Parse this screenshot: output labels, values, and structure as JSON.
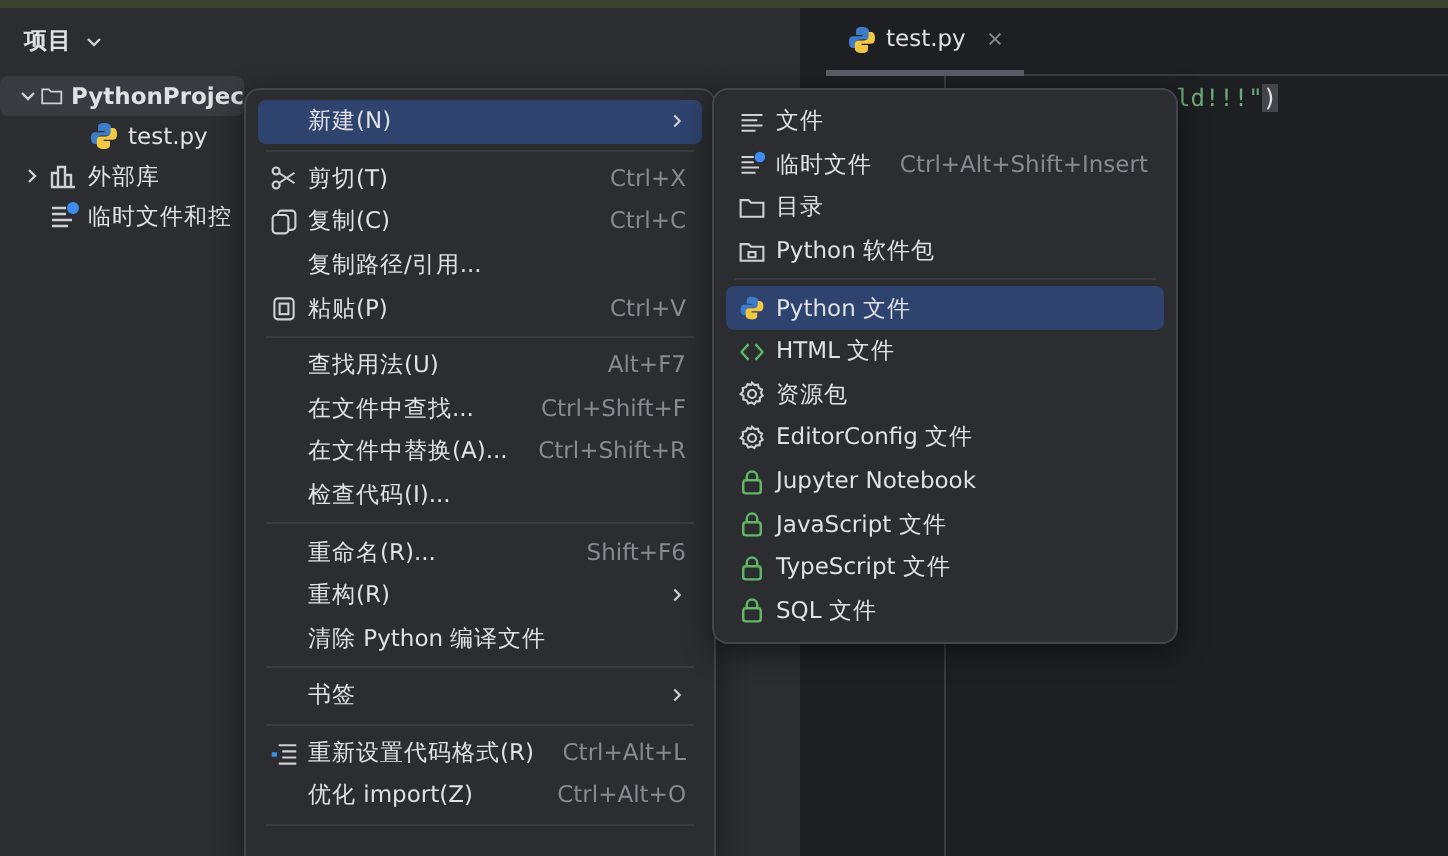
{
  "project_panel": {
    "title": "项目",
    "tree": [
      {
        "label": "PythonProjec",
        "kind": "folder",
        "expanded": true,
        "selected": true,
        "children": [
          {
            "label": "test.py",
            "kind": "python",
            "selected": false
          }
        ]
      },
      {
        "label": "外部库",
        "kind": "library",
        "expanded": false,
        "selected": false
      },
      {
        "label": "临时文件和控",
        "kind": "scratches",
        "selected": false
      }
    ]
  },
  "editor": {
    "tabs": [
      {
        "label": "test.py",
        "selected": true
      }
    ],
    "code_tokens": [
      {
        "text": "ld!!!\"",
        "kind": "string"
      },
      {
        "text": ")",
        "kind": "bracket-match"
      }
    ]
  },
  "context_menu": {
    "items": [
      {
        "kind": "plain",
        "label": "新建(N)",
        "submenu": true,
        "selected": true
      },
      {
        "kind": "separator"
      },
      {
        "kind": "cut",
        "label": "剪切(T)",
        "shortcut": "Ctrl+X",
        "selected": false
      },
      {
        "kind": "copy",
        "label": "复制(C)",
        "shortcut": "Ctrl+C",
        "selected": false
      },
      {
        "kind": "plain",
        "label": "复制路径/引用...",
        "selected": false
      },
      {
        "kind": "paste",
        "label": "粘贴(P)",
        "shortcut": "Ctrl+V",
        "selected": false
      },
      {
        "kind": "separator"
      },
      {
        "kind": "plain",
        "label": "查找用法(U)",
        "shortcut": "Alt+F7",
        "selected": false
      },
      {
        "kind": "plain",
        "label": "在文件中查找...",
        "shortcut": "Ctrl+Shift+F",
        "selected": false
      },
      {
        "kind": "plain",
        "label": "在文件中替换(A)...",
        "shortcut": "Ctrl+Shift+R",
        "selected": false
      },
      {
        "kind": "plain",
        "label": "检查代码(I)...",
        "selected": false
      },
      {
        "kind": "separator"
      },
      {
        "kind": "plain",
        "label": "重命名(R)...",
        "shortcut": "Shift+F6",
        "selected": false
      },
      {
        "kind": "plain",
        "label": "重构(R)",
        "submenu": true,
        "selected": false
      },
      {
        "kind": "plain",
        "label": "清除 Python 编译文件",
        "selected": false
      },
      {
        "kind": "separator"
      },
      {
        "kind": "plain",
        "label": "书签",
        "submenu": true,
        "selected": false
      },
      {
        "kind": "separator"
      },
      {
        "kind": "format",
        "label": "重新设置代码格式(R)",
        "shortcut": "Ctrl+Alt+L",
        "selected": false
      },
      {
        "kind": "plain",
        "label": "优化 import(Z)",
        "shortcut": "Ctrl+Alt+O",
        "selected": false
      },
      {
        "kind": "separator"
      }
    ]
  },
  "new_submenu": {
    "items": [
      {
        "kind": "file",
        "label": "文件",
        "selected": false
      },
      {
        "kind": "scratch",
        "label": "临时文件",
        "shortcut": "Ctrl+Alt+Shift+Insert",
        "selected": false
      },
      {
        "kind": "folder",
        "label": "目录",
        "selected": false
      },
      {
        "kind": "package",
        "label": "Python 软件包",
        "selected": false
      },
      {
        "kind": "separator"
      },
      {
        "kind": "python",
        "label": "Python 文件",
        "selected": true
      },
      {
        "kind": "html",
        "label": "HTML 文件",
        "selected": false
      },
      {
        "kind": "gear",
        "label": "资源包",
        "selected": false
      },
      {
        "kind": "gear",
        "label": "EditorConfig 文件",
        "selected": false
      },
      {
        "kind": "lock",
        "label": "Jupyter Notebook",
        "selected": false
      },
      {
        "kind": "lock",
        "label": "JavaScript 文件",
        "selected": false
      },
      {
        "kind": "lock",
        "label": "TypeScript 文件",
        "selected": false
      },
      {
        "kind": "lock",
        "label": "SQL 文件",
        "selected": false
      }
    ]
  }
}
